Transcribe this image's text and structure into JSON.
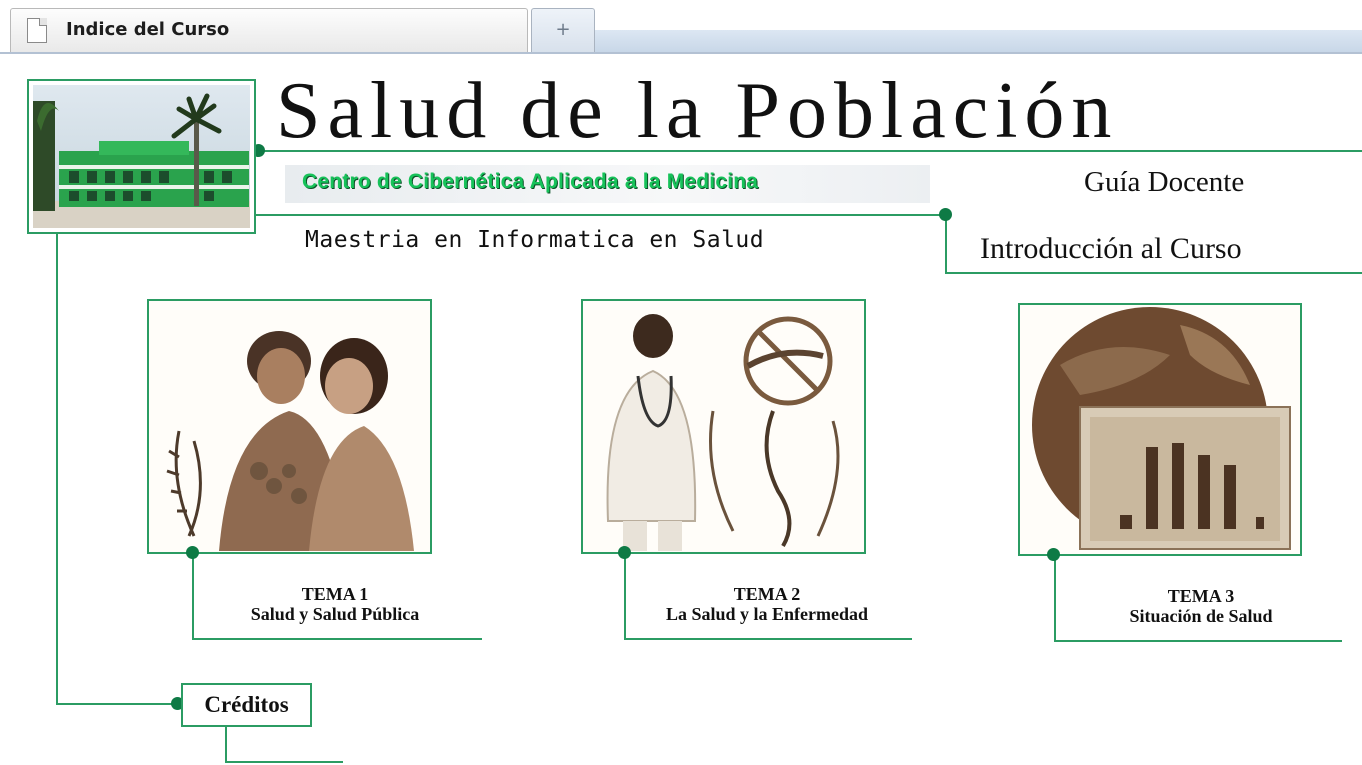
{
  "browser": {
    "tab_title": "Indice del Curso",
    "new_tab_glyph": "+",
    "page_icon": "page-icon"
  },
  "header": {
    "title": "Salud de la Población",
    "center_name": "Centro de Cibernética Aplicada a la Medicina",
    "guide": "Guía Docente",
    "program": "Maestria en Informatica en Salud",
    "intro_link": "Introducción al Curso"
  },
  "temas": [
    {
      "number": "TEMA 1",
      "title": "Salud y Salud Pública"
    },
    {
      "number": "TEMA 2",
      "title": "La Salud y la Enfermedad"
    },
    {
      "number": "TEMA 3",
      "title": "Situación de Salud"
    }
  ],
  "credits": {
    "label": "Créditos"
  },
  "colors": {
    "accent_green": "#2b9c63",
    "dot_green": "#0e7a45",
    "title_green": "#17c25a",
    "sepia": "#7a5a3e"
  }
}
